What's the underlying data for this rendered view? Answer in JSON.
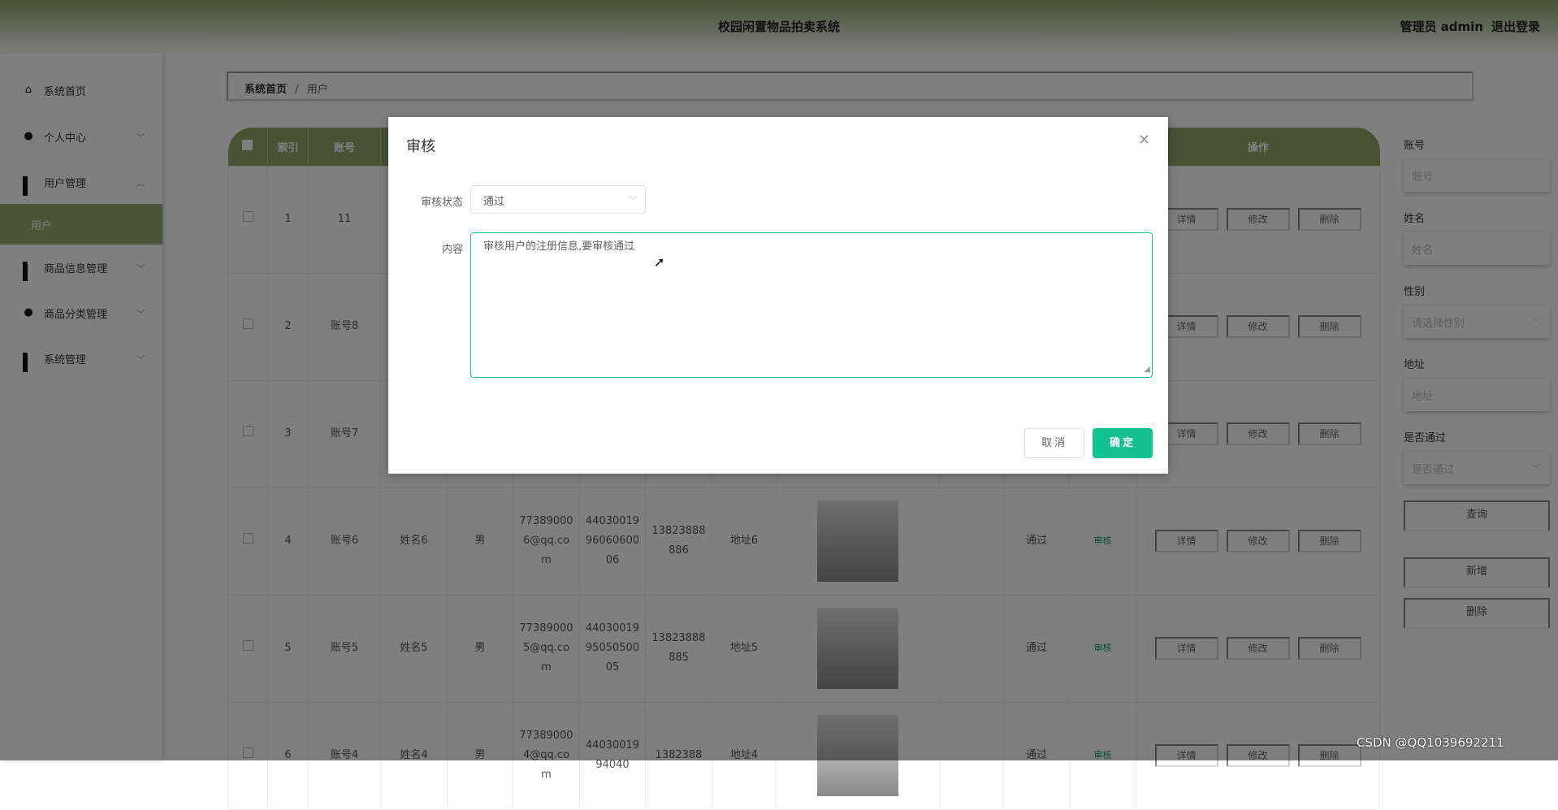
{
  "header": {
    "title": "校园闲置物品拍卖系统",
    "user": "管理员 admin",
    "logout": "退出登录"
  },
  "sidebar": {
    "items": [
      {
        "label": "系统首页",
        "icon": "home-icon"
      },
      {
        "label": "个人中心",
        "icon": "user-icon"
      },
      {
        "label": "用户管理",
        "icon": "grid-icon"
      },
      {
        "label": "用户",
        "active": true
      },
      {
        "label": "商品信息管理",
        "icon": "grid-icon"
      },
      {
        "label": "商品分类管理",
        "icon": "bulb-icon"
      },
      {
        "label": "系统管理",
        "icon": "grid-icon"
      }
    ]
  },
  "breadcrumb": {
    "home": "系统首页",
    "sep": "/",
    "current": "用户"
  },
  "table": {
    "headers": {
      "index": "索引",
      "account": "账号",
      "action": "操作"
    },
    "rows": [
      {
        "index": "1",
        "account": "11"
      },
      {
        "index": "2",
        "account": "账号8"
      },
      {
        "index": "3",
        "account": "账号7"
      },
      {
        "index": "4",
        "account": "账号6",
        "name": "姓名6",
        "gender": "男",
        "email": "773890006@qq.com",
        "idcard": "440300199606060006",
        "phone": "13823888886",
        "address": "地址6",
        "passed": "通过",
        "audit": "审核"
      },
      {
        "index": "5",
        "account": "账号5",
        "name": "姓名5",
        "gender": "男",
        "email": "773890005@qq.com",
        "idcard": "440300199505050005",
        "phone": "13823888885",
        "address": "地址5",
        "passed": "通过",
        "audit": "审核"
      },
      {
        "index": "6",
        "account": "账号4",
        "name": "姓名4",
        "gender": "男",
        "email": "773890004@qq.com",
        "idcard": "4403001994040",
        "phone": "1382388",
        "address": "地址4",
        "passed": "通过",
        "audit": "审核"
      }
    ],
    "ops": {
      "detail": "详情",
      "edit": "修改",
      "delete": "删除"
    }
  },
  "filter": {
    "account_label": "账号",
    "account_placeholder": "账号",
    "name_label": "姓名",
    "name_placeholder": "姓名",
    "gender_label": "性别",
    "gender_placeholder": "请选择性别",
    "address_label": "地址",
    "address_placeholder": "地址",
    "passed_label": "是否通过",
    "passed_placeholder": "是否通过",
    "query": "查询",
    "add": "新增",
    "delete": "删除"
  },
  "modal": {
    "title": "审核",
    "status_label": "审核状态",
    "status_value": "通过",
    "content_label": "内容",
    "content_value": "审核用户的注册信息,要审核通过",
    "cancel": "取消",
    "confirm": "确定"
  },
  "watermark": "CSDN @QQ1039692211",
  "colors": {
    "theme": "#95a56d",
    "confirm": "#13c290",
    "textarea_border": "#1abc9c"
  }
}
